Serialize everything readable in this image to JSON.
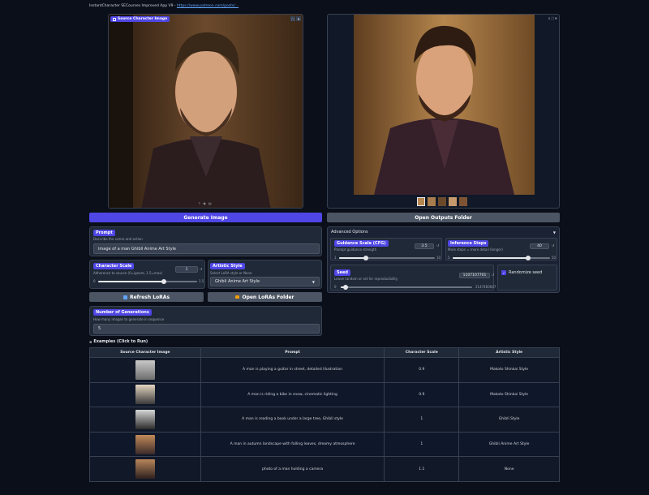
{
  "header": {
    "title": "InstantCharacter SECourses Improved App V9 -",
    "link": "https://www.patreon.com/posts/..."
  },
  "source_image": {
    "label": "Source Character Image"
  },
  "buttons": {
    "generate": "Generate Image",
    "open_outputs": "Open Outputs Folder",
    "refresh_loras": "Refresh LoRAs",
    "open_loras": "Open LoRAs Folder"
  },
  "prompt": {
    "label": "Prompt",
    "sublabel": "Describe the scene and action",
    "value": "image of a man Ghibli Anime Art Style"
  },
  "character_scale": {
    "label": "Character Scale",
    "sublabel": "Adherence to source (0=ignore, 1.5=max)",
    "value": "1",
    "min": "0",
    "max": "1.5",
    "fraction": 0.667
  },
  "artistic_style": {
    "label": "Artistic Style",
    "sublabel": "Select LoRA style or None",
    "value": "Ghibli Anime Art Style"
  },
  "generations": {
    "label": "Number of Generations",
    "sublabel": "How many images to generate in sequence",
    "value": "5"
  },
  "advanced": {
    "label": "Advanced Options",
    "guidance": {
      "label": "Guidance Scale (CFG)",
      "sublabel": "Prompt guidance strength",
      "value": "3.5",
      "min": "1",
      "max": "10",
      "fraction": 0.278
    },
    "steps": {
      "label": "Inference Steps",
      "sublabel": "More steps = more detail (longer)",
      "value": "40",
      "min": "5",
      "max": "50",
      "fraction": 0.778
    },
    "seed": {
      "label": "Seed",
      "sublabel": "Leave random or set for reproducibility",
      "value": "1107107701",
      "min": "0",
      "max": "2147483647",
      "fraction": 0.04
    },
    "randomize_label": "Randomize seed"
  },
  "examples": {
    "title": "Examples (Click to Run)",
    "columns": [
      "Source Character Image",
      "Prompt",
      "Character Scale",
      "Artistic Style"
    ],
    "rows": [
      {
        "prompt": "A man is playing a guitar in street, detailed illustration",
        "scale": "0.9",
        "style": "Makoto Shinkai Style"
      },
      {
        "prompt": "A man is riding a bike in snow, cinematic lighting",
        "scale": "0.9",
        "style": "Makoto Shinkai Style"
      },
      {
        "prompt": "A man is reading a book under a large tree, Ghibli style",
        "scale": "1",
        "style": "Ghibli Style"
      },
      {
        "prompt": "A man in autumn landscape with falling leaves, dreamy atmosphere",
        "scale": "1",
        "style": "Ghibli Anime Art Style"
      },
      {
        "prompt": "photo of a man holding a camera",
        "scale": "1.1",
        "style": "None"
      }
    ]
  },
  "colors": {
    "accent": "#4f46e5",
    "background": "#0b0f19",
    "panel": "#1f2937"
  }
}
